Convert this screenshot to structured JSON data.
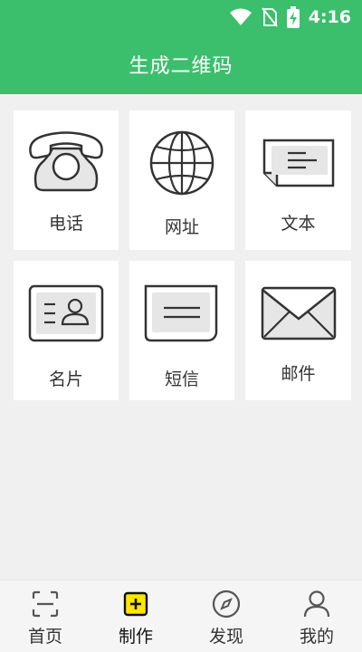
{
  "status_bar": {
    "time": "4:16"
  },
  "app_bar": {
    "title": "生成二维码"
  },
  "tiles": [
    {
      "label": "电话",
      "icon": "telephone-icon"
    },
    {
      "label": "网址",
      "icon": "globe-icon"
    },
    {
      "label": "文本",
      "icon": "text-note-icon"
    },
    {
      "label": "名片",
      "icon": "business-card-icon"
    },
    {
      "label": "短信",
      "icon": "sms-icon"
    },
    {
      "label": "邮件",
      "icon": "envelope-icon"
    }
  ],
  "bottom_nav": {
    "items": [
      {
        "label": "首页",
        "icon": "scan-icon"
      },
      {
        "label": "制作",
        "icon": "create-plus-icon"
      },
      {
        "label": "发现",
        "icon": "compass-icon"
      },
      {
        "label": "我的",
        "icon": "user-icon"
      }
    ],
    "active": "制作"
  },
  "colors": {
    "primary": "#3cbf6d",
    "accent": "#ffe600",
    "icon_stroke": "#333333",
    "icon_fill": "#e6e6e6"
  }
}
